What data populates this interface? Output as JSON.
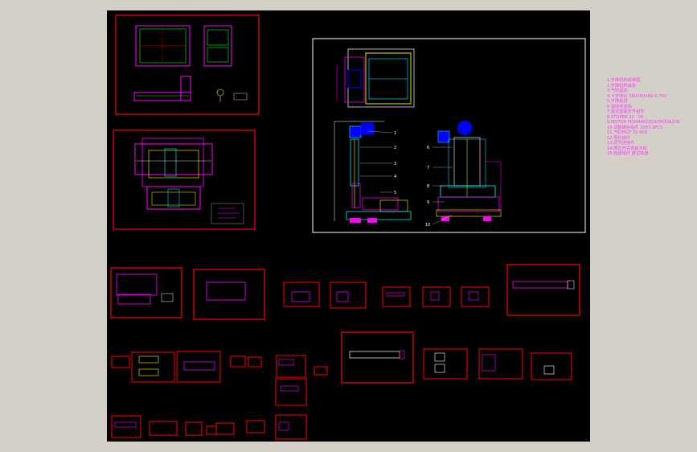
{
  "viewport": {
    "background": "#d4d0c8",
    "canvas_background": "#000000"
  },
  "colors": {
    "frame_red": "#ff0000",
    "frame_white": "#ffffff",
    "magenta": "#ff00ff",
    "cyan": "#00ffff",
    "yellow": "#ffff00",
    "green": "#00ff00",
    "blue": "#0000ff"
  },
  "legend": {
    "items": [
      "1.升降机构组装图",
      "2.升降机构底板",
      "3.气缸固定",
      "4.十字滑台 S60X60X60-0.75C",
      "5.升降轨道",
      "6.滑块安装板",
      "7.固定座固定件组件",
      "8.STOPER  32 - 50",
      "9.MOTOR  MSMA4KGB1E/MODA20B",
      "10.调整螺丝组件 2063  3PCS",
      "11.气缸MGP  32  40S",
      "12.导柱组件",
      "13.调节连接件",
      "14.限位开关安装支架",
      "15.吸盘组件  真空吸盘"
    ]
  },
  "callouts": [
    "1",
    "2",
    "3",
    "4",
    "5",
    "6",
    "7",
    "8",
    "9",
    "10",
    "11",
    "12",
    "13",
    "14",
    "15"
  ]
}
